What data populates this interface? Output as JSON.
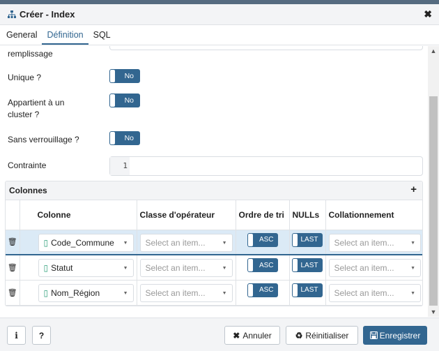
{
  "title": "Créer - Index",
  "tabs": [
    "General",
    "Définition",
    "SQL"
  ],
  "active_tab": "Définition",
  "fields": {
    "remplissage_label": "remplissage",
    "unique_label": "Unique ?",
    "unique_value": "No",
    "cluster_label_1": "Appartient à un",
    "cluster_label_2": "cluster ?",
    "cluster_value": "No",
    "sans_verrou_label": "Sans verrouillage ?",
    "sans_verrou_value": "No",
    "contrainte_label": "Contrainte",
    "contrainte_line": "1"
  },
  "columns_panel": {
    "title": "Colonnes",
    "add": "+",
    "headers": [
      "",
      "Colonne",
      "Classe d'opérateur",
      "Ordre de tri",
      "NULLs",
      "Collationnement"
    ],
    "rows": [
      {
        "colonne": "Code_Commune",
        "classe": "Select an item...",
        "ordre": "ASC",
        "nulls": "LAST",
        "collation": "Select an item..."
      },
      {
        "colonne": "Statut",
        "classe": "Select an item...",
        "ordre": "ASC",
        "nulls": "LAST",
        "collation": "Select an item..."
      },
      {
        "colonne": "Nom_Région",
        "classe": "Select an item...",
        "ordre": "ASC",
        "nulls": "LAST",
        "collation": "Select an item..."
      }
    ]
  },
  "footer": {
    "info": "i",
    "help": "?",
    "annuler": "Annuler",
    "reinitialiser": "Réinitialiser",
    "enregistrer": "Enregistrer"
  },
  "colors": {
    "accent": "#326690",
    "selected_row": "#dbeaf6",
    "column_icon": "#2e9f7a"
  }
}
